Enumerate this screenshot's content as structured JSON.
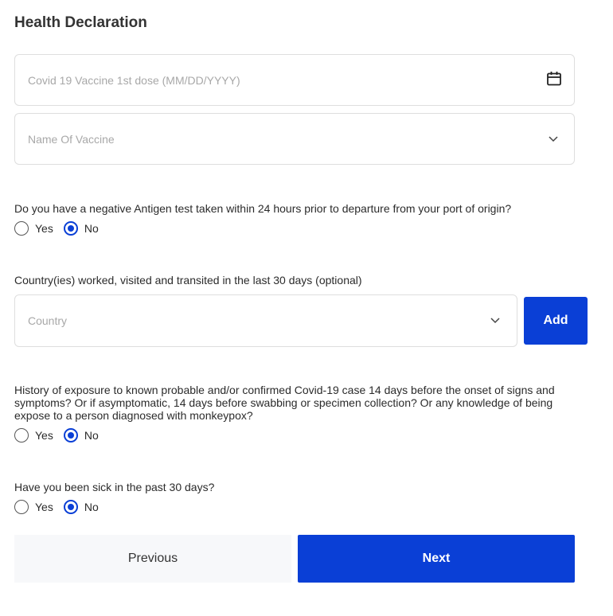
{
  "form": {
    "title": "Health Declaration",
    "vaccine_date_placeholder": "Covid 19 Vaccine 1st dose (MM/DD/YYYY)",
    "vaccine_name_placeholder": "Name Of Vaccine",
    "antigen_question": "Do you have a negative Antigen test taken within 24 hours prior to departure from your port of origin?",
    "antigen_options": [
      {
        "label": "Yes",
        "selected": false
      },
      {
        "label": "No",
        "selected": true
      }
    ],
    "countries_question": "Country(ies) worked, visited and transited in the last 30 days (optional)",
    "country_placeholder": "Country",
    "add_label": "Add",
    "exposure_question": "History of exposure to known probable and/or confirmed Covid-19 case 14 days before the onset of signs and symptoms? Or if asymptomatic, 14 days before swabbing or specimen collection? Or any knowledge of being expose to a person diagnosed with monkeypox?",
    "exposure_options": [
      {
        "label": "Yes",
        "selected": false
      },
      {
        "label": "No",
        "selected": true
      }
    ],
    "sick_question": "Have you been sick in the past 30 days?",
    "sick_options": [
      {
        "label": "Yes",
        "selected": false
      },
      {
        "label": "No",
        "selected": true
      }
    ],
    "previous_label": "Previous",
    "next_label": "Next"
  },
  "colors": {
    "accent": "#0a3fd6",
    "border": "#dedede",
    "placeholder": "#a8a8a8"
  },
  "icons": [
    "calendar-icon",
    "chevron-down-icon"
  ]
}
